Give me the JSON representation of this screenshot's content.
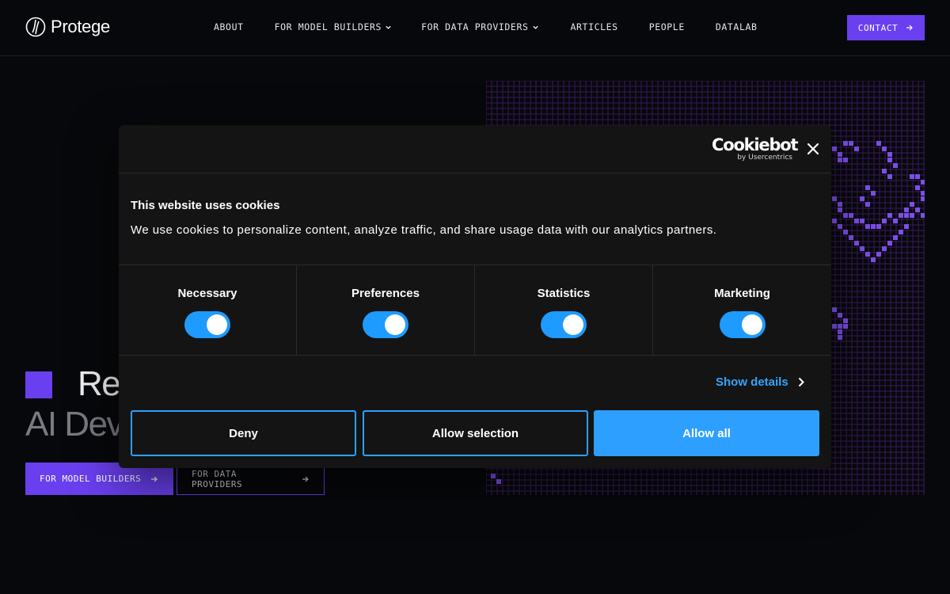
{
  "brand": {
    "name": "Protege",
    "logo_icon": "protege-logo-icon"
  },
  "nav": {
    "items": [
      {
        "label": "ABOUT",
        "dropdown": false
      },
      {
        "label": "FOR MODEL BUILDERS",
        "dropdown": true
      },
      {
        "label": "FOR DATA PROVIDERS",
        "dropdown": true
      },
      {
        "label": "ARTICLES",
        "dropdown": false
      },
      {
        "label": "PEOPLE",
        "dropdown": false
      },
      {
        "label": "DATALAB",
        "dropdown": false
      }
    ],
    "contact_label": "CONTACT"
  },
  "hero": {
    "line1": "Re",
    "line2": "AI Dev",
    "cta_primary": "FOR MODEL BUILDERS",
    "cta_secondary": "FOR DATA PROVIDERS"
  },
  "cookie": {
    "brand_name": "Cookiebot",
    "brand_by": "by Usercentrics",
    "title": "This website uses cookies",
    "text": "We use cookies to personalize content, analyze traffic, and share usage data with our analytics partners.",
    "categories": [
      {
        "label": "Necessary",
        "enabled": true
      },
      {
        "label": "Preferences",
        "enabled": true
      },
      {
        "label": "Statistics",
        "enabled": true
      },
      {
        "label": "Marketing",
        "enabled": true
      }
    ],
    "show_details": "Show details",
    "deny": "Deny",
    "allow_selection": "Allow selection",
    "allow_all": "Allow all"
  },
  "colors": {
    "background": "#07080b",
    "accent": "#6a3ff0",
    "dialog_bg": "#141414",
    "cookie_blue": "#2d9fff",
    "grid_line": "#3a1a5c",
    "grid_cell": "#7b4fe8"
  }
}
